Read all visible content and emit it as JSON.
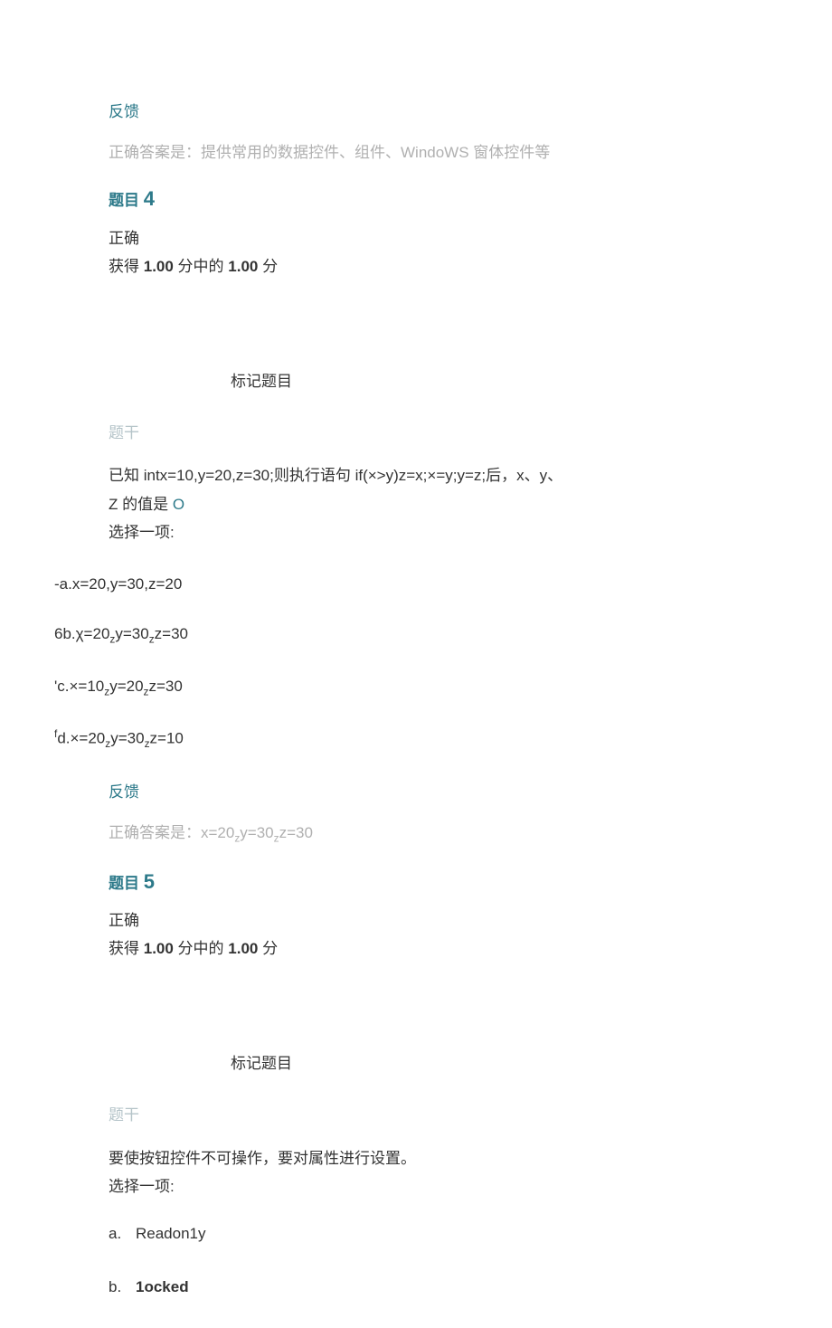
{
  "feedback_label": "反馈",
  "correct_prefix": "正确答案是：",
  "q3_answer": "提供常用的数据控件、组件、WindoWS 窗体控件等",
  "q4": {
    "title_prefix": "题目 ",
    "number": "4",
    "status": "正确",
    "score_prefix": "获得 ",
    "score1": "1.00",
    "score_mid": " 分中的 ",
    "score2": "1.00",
    "score_suffix": " 分",
    "mark": "标记题目",
    "stem_label": "题干",
    "stem_line1": "已知 intx=10,y=20,z=30;则执行语句 if(×>y)z=x;×=y;y=z;后，x、y、",
    "stem_line2_a": "Z 的值是 ",
    "stem_line2_b": "O",
    "select_one": "选择一项:",
    "opt_a": "-a.x=20,y=30,z=20",
    "opt_b_pre": "6b.χ=20",
    "opt_b_mid1": "y=30",
    "opt_b_end": "z=30",
    "opt_c_pre": "'c.×=10",
    "opt_c_mid1": "y=20",
    "opt_c_end": "z=30",
    "opt_d_sup": "f",
    "opt_d_pre": "d.×=20",
    "opt_d_mid1": "y=30",
    "opt_d_end": "z=10",
    "ans_pre": "x=20",
    "ans_mid1": "y=30",
    "ans_end": "z=30"
  },
  "q5": {
    "title_prefix": "题目 ",
    "number": "5",
    "status": "正确",
    "score_prefix": "获得 ",
    "score1": "1.00",
    "score_mid": " 分中的 ",
    "score2": "1.00",
    "score_suffix": " 分",
    "mark": "标记题目",
    "stem_label": "题干",
    "stem_line1": "要使按钮控件不可操作，要对属性进行设置。",
    "select_one": "选择一项:",
    "opt_a_label": "a.",
    "opt_a_text": "Readon1y",
    "opt_b_label": "b.",
    "opt_b_text": "1ocked"
  },
  "sub_z": "z"
}
